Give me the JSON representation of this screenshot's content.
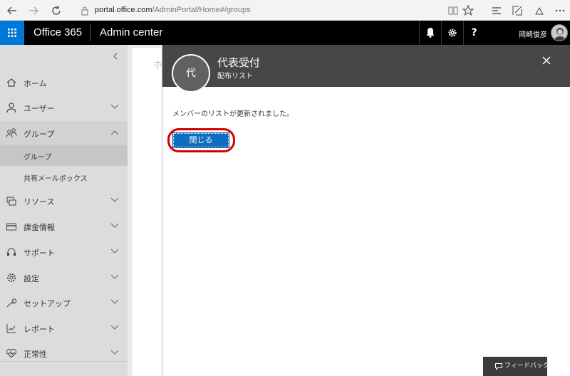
{
  "browser": {
    "url_domain": "portal.office.com",
    "url_path": "/AdminPortal/Home#/groups",
    "url_protocol": ""
  },
  "header": {
    "brand": "Office 365",
    "app_name": "Admin center",
    "help_label": "?",
    "user_name": "岡崎俊彦"
  },
  "leftnav": {
    "items": [
      {
        "label": "ホーム",
        "icon": "home-icon"
      },
      {
        "label": "ユーザー",
        "icon": "user-icon"
      },
      {
        "label": "グループ",
        "icon": "group-icon"
      },
      {
        "label": "リソース",
        "icon": "resources-icon"
      },
      {
        "label": "課金情報",
        "icon": "billing-icon"
      },
      {
        "label": "サポート",
        "icon": "support-icon"
      },
      {
        "label": "設定",
        "icon": "settings-icon"
      },
      {
        "label": "セットアップ",
        "icon": "setup-icon"
      },
      {
        "label": "レポート",
        "icon": "reports-icon"
      },
      {
        "label": "正常性",
        "icon": "health-icon"
      }
    ],
    "subitems": [
      {
        "label": "グループ",
        "active": true
      },
      {
        "label": "共有メールボックス",
        "active": false
      }
    ]
  },
  "background": {
    "crumb": "ホ"
  },
  "panel": {
    "avatar_initial": "代",
    "title": "代表受付",
    "subtitle": "配布リスト",
    "message": "メンバーのリストが更新されました。",
    "close_button_label": "閉じる",
    "feedback_label": "フィードバック"
  },
  "colors": {
    "accent": "#0078d7",
    "button": "#106ebe",
    "highlight_ring": "#d40000",
    "panel_header": "#474747"
  }
}
